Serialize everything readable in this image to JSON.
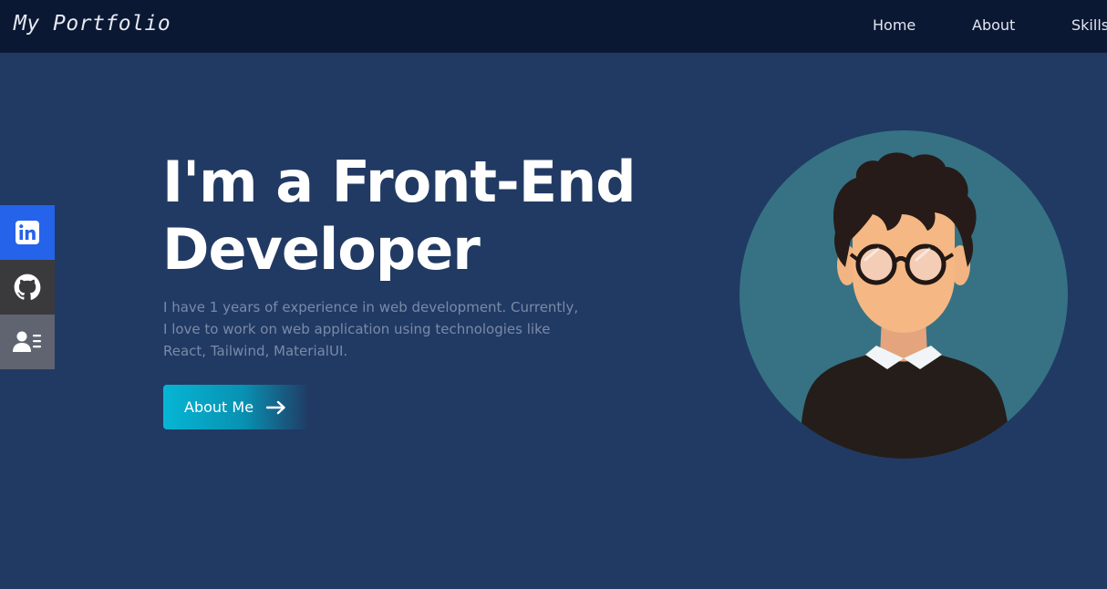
{
  "navbar": {
    "brand": "My Portfolio",
    "links": [
      {
        "label": "Home"
      },
      {
        "label": "About"
      },
      {
        "label": "Skills"
      }
    ]
  },
  "social": {
    "items": [
      {
        "icon": "linkedin-icon"
      },
      {
        "icon": "github-icon"
      },
      {
        "icon": "resume-icon"
      }
    ]
  },
  "hero": {
    "title_line1": "I'm a Front-End",
    "title_line2": "Developer",
    "description": "I have 1 years of experience in web development. Currently, I love to work on web application using technologies like React, Tailwind, MaterialUI.",
    "cta_label": "About Me",
    "cta_icon": "arrow-right-icon",
    "avatar_icon": "developer-avatar-icon"
  },
  "colors": {
    "background": "#213a63",
    "navbar": "#0b1834",
    "accent": "#06b6d4",
    "linkedin": "#2563eb",
    "github": "#3a3a3d",
    "resume": "#5f6470",
    "avatar_bg": "#367283"
  }
}
